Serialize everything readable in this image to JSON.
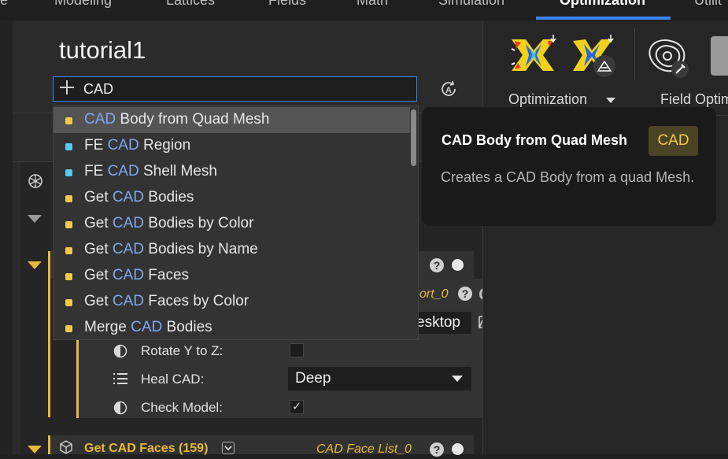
{
  "tabs": [
    {
      "label": "e"
    },
    {
      "label": "Modeling"
    },
    {
      "label": "Lattices"
    },
    {
      "label": "Fields"
    },
    {
      "label": "Math"
    },
    {
      "label": "Simulation"
    },
    {
      "label": "Optimization",
      "active": true
    },
    {
      "label": "Utilit"
    }
  ],
  "accent_color": "#3b82f6",
  "panel": {
    "title": "tutorial1",
    "search": {
      "value": "CAD"
    }
  },
  "dropdown": {
    "query": "CAD",
    "items": [
      {
        "before": "",
        "match": "CAD",
        "after": " Body from Quad Mesh",
        "color": "#f2c94c",
        "selected": true
      },
      {
        "before": "FE ",
        "match": "CAD",
        "after": " Region",
        "color": "#56ccf2"
      },
      {
        "before": "FE ",
        "match": "CAD",
        "after": " Shell Mesh",
        "color": "#56ccf2"
      },
      {
        "before": "Get ",
        "match": "CAD",
        "after": " Bodies",
        "color": "#f2c94c"
      },
      {
        "before": "Get ",
        "match": "CAD",
        "after": " Bodies by Color",
        "color": "#f2c94c"
      },
      {
        "before": "Get ",
        "match": "CAD",
        "after": " Bodies by Name",
        "color": "#f2c94c"
      },
      {
        "before": "Get ",
        "match": "CAD",
        "after": " Faces",
        "color": "#f2c94c"
      },
      {
        "before": "Get ",
        "match": "CAD",
        "after": " Faces by Color",
        "color": "#f2c94c"
      },
      {
        "before": "Merge ",
        "match": "CAD",
        "after": " Bodies",
        "color": "#f2c94c"
      }
    ]
  },
  "ribbon": {
    "optimization_label": "Optimization",
    "field_label": "Field Optim"
  },
  "tooltip": {
    "title": "CAD Body from Quad Mesh",
    "badge": "CAD",
    "description": "Creates a CAD Body from a quad Mesh."
  },
  "node_import": {
    "output_label": "ort_0",
    "path_value": "esktop",
    "rows": [
      {
        "label": "Rotate Y to Z:",
        "checked": false
      },
      {
        "label": "Heal CAD:",
        "value": "Deep"
      },
      {
        "label": "Check Model:",
        "checked": true
      }
    ]
  },
  "node_faces": {
    "title": "Get CAD Faces (159)",
    "output_label": "CAD Face List_0"
  },
  "icons": [
    "plus-icon",
    "auto-refresh-icon",
    "openai-icon",
    "folder-open-icon",
    "list-icon",
    "half-circle-icon",
    "help-icon",
    "chevron-down-icon",
    "cube-icon"
  ]
}
